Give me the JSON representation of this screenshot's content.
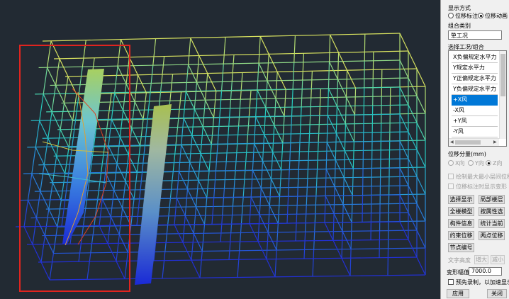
{
  "panel": {
    "display_mode_label": "显示方式",
    "display_options": [
      {
        "label": "位移标注",
        "checked": false
      },
      {
        "label": "位移动画",
        "checked": true
      }
    ],
    "combo_category_label": "组合类别",
    "combo_category_value": "单工况",
    "select_case_label": "选择工况/组合",
    "cases": [
      "X负偏规定水平力",
      "Y规定水平力",
      "Y正偏规定水平力",
      "Y负偏规定水平力",
      "+X风",
      "-X风",
      "+Y风",
      "-Y风"
    ],
    "selected_case": "+X风",
    "displacement_component_label": "位移分量(mm)",
    "components": [
      {
        "label": "X向",
        "checked": false
      },
      {
        "label": "Y向",
        "checked": false
      },
      {
        "label": "Z向",
        "checked": true
      }
    ],
    "checkbox_max_min": "绘制最大最小层间位移",
    "checkbox_annotate_deform": "位移标注时显示变形",
    "buttons": {
      "select_display": "选择显示",
      "local_floor": "局部楼层",
      "full_model": "全楼模型",
      "by_attribute": "按属性选",
      "member_info": "构件信息",
      "current_stats": "统计当前",
      "constraint_disp": "约束位移",
      "two_point_disp": "两点位移",
      "node_number": "节点编号"
    },
    "text_height_label": "文字高度",
    "enlarge_button": "增大",
    "reduce_button": "减小",
    "deform_amplitude_label": "变形幅值",
    "deform_amplitude_value": "7000.0",
    "pre_record_label": "预先录制，以加速显示",
    "apply_button": "应用",
    "close_button": "关闭"
  },
  "colors": {
    "viewport_bg": "#222a33",
    "highlight_box": "#e0241f",
    "list_selected": "#0078d7",
    "deform_low": "#2030d0",
    "deform_mid": "#20d0c0",
    "deform_high": "#e0e060"
  }
}
